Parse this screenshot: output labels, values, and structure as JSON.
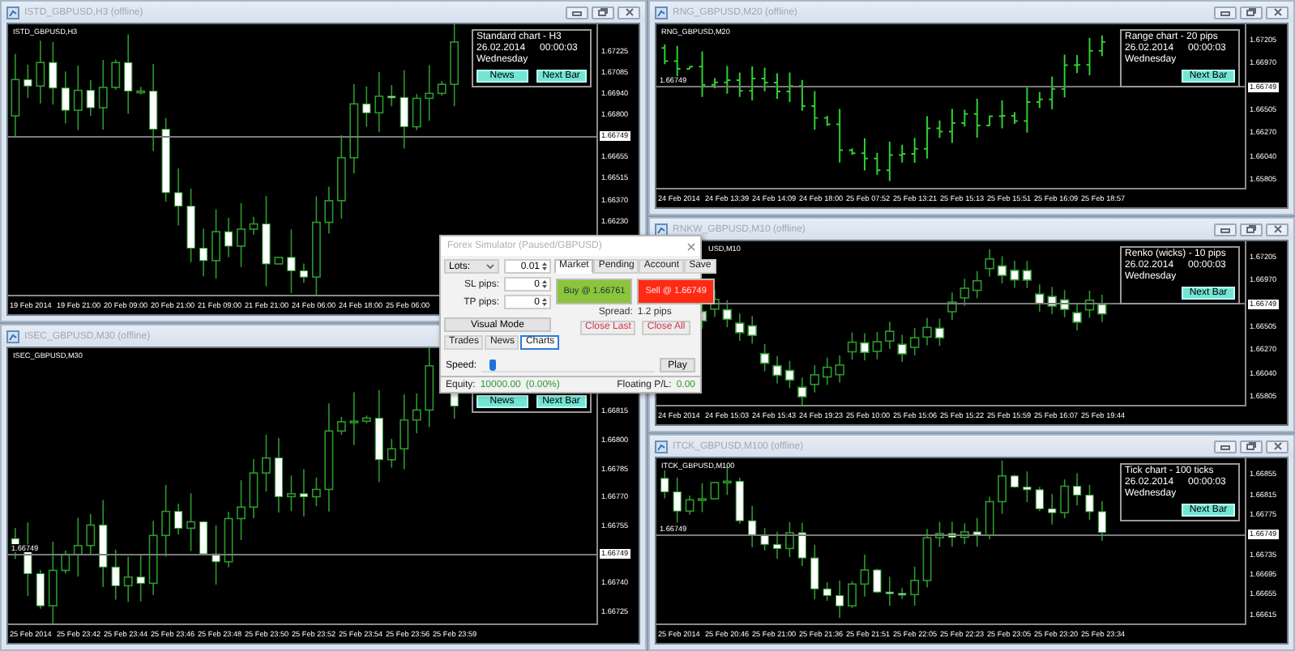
{
  "windows": [
    {
      "title": "ISTD_GBPUSD,H3 (offline)",
      "label": "ISTD_GBPUSD,H3",
      "kind": "candles",
      "window_buttons": true,
      "price_ticks": [
        {
          "text": "1.67225",
          "current": false
        },
        {
          "text": "1.67085",
          "current": false
        },
        {
          "text": "1.66940",
          "current": false
        },
        {
          "text": "1.66800",
          "current": false
        },
        {
          "text": "1.66749",
          "current": true
        },
        {
          "text": "1.66655",
          "current": false
        },
        {
          "text": "1.66515",
          "current": false
        },
        {
          "text": "1.66370",
          "current": false
        },
        {
          "text": "1.66230",
          "current": false
        }
      ],
      "time_ticks": [
        "19 Feb 2014",
        "19 Feb 21:00",
        "20 Feb 09:00",
        "20 Feb 21:00",
        "21 Feb 09:00",
        "21 Feb 21:00",
        "24 Feb 06:00",
        "24 Feb 18:00",
        "25 Feb 06:00"
      ],
      "info": {
        "title": "Standard chart - H3",
        "date": "26.02.2014",
        "time": "00:00:03",
        "day": "Wednesday",
        "buttons": [
          "News",
          "Next Bar"
        ]
      }
    },
    {
      "title": "RNG_GBPUSD,M20 (offline)",
      "label": "RNG_GBPUSD,M20",
      "kind": "bars",
      "window_buttons": true,
      "price_line_label": "1.66749",
      "price_ticks": [
        {
          "text": "1.67205",
          "current": false
        },
        {
          "text": "1.66970",
          "current": false
        },
        {
          "text": "1.66749",
          "current": true
        },
        {
          "text": "1.66505",
          "current": false
        },
        {
          "text": "1.66270",
          "current": false
        },
        {
          "text": "1.66040",
          "current": false
        },
        {
          "text": "1.65805",
          "current": false
        }
      ],
      "time_ticks": [
        "24 Feb 2014",
        "24 Feb 13:39",
        "24 Feb 14:09",
        "24 Feb 18:00",
        "25 Feb 07:52",
        "25 Feb 13:21",
        "25 Feb 15:13",
        "25 Feb 15:51",
        "25 Feb 16:09",
        "25 Feb 18:57"
      ],
      "info": {
        "title": "Range chart - 20 pips",
        "date": "26.02.2014",
        "time": "00:00:03",
        "day": "Wednesday",
        "buttons": [
          "Next Bar"
        ]
      }
    },
    {
      "title": "RNKW_GBPUSD,M10 (offline)",
      "label": "USD,M10",
      "kind": "renko",
      "window_buttons": true,
      "price_ticks": [
        {
          "text": "1.67205",
          "current": false
        },
        {
          "text": "1.66970",
          "current": false
        },
        {
          "text": "1.66749",
          "current": true
        },
        {
          "text": "1.66505",
          "current": false
        },
        {
          "text": "1.66270",
          "current": false
        },
        {
          "text": "1.66040",
          "current": false
        },
        {
          "text": "1.65805",
          "current": false
        }
      ],
      "time_ticks": [
        "24 Feb 2014",
        "24 Feb 15:03",
        "24 Feb 15:43",
        "24 Feb 19:23",
        "25 Feb 10:00",
        "25 Feb 15:06",
        "25 Feb 15:22",
        "25 Feb 15:59",
        "25 Feb 16:07",
        "25 Feb 19:44"
      ],
      "info": {
        "title": "Renko (wicks) - 10 pips",
        "date": "26.02.2014",
        "time": "00:00:03",
        "day": "Wednesday",
        "buttons": [
          "Next Bar"
        ]
      }
    },
    {
      "title": "ISEC_GBPUSD,M30 (offline)",
      "label": "ISEC_GBPUSD,M30",
      "kind": "candles",
      "window_buttons": false,
      "price_line_label": "1.66749",
      "price_ticks": [
        {
          "text": "1.66815",
          "current": false
        },
        {
          "text": "1.66800",
          "current": false
        },
        {
          "text": "1.66785",
          "current": false
        },
        {
          "text": "1.66770",
          "current": false
        },
        {
          "text": "1.66755",
          "current": false
        },
        {
          "text": "1.66749",
          "current": true
        },
        {
          "text": "1.66740",
          "current": false
        },
        {
          "text": "1.66725",
          "current": false
        }
      ],
      "time_ticks": [
        "25 Feb 2014",
        "25 Feb 23:42",
        "25 Feb 23:44",
        "25 Feb 23:46",
        "25 Feb 23:48",
        "25 Feb 23:50",
        "25 Feb 23:52",
        "25 Feb 23:54",
        "25 Feb 23:56",
        "25 Feb 23:59"
      ],
      "info": {
        "buttons": [
          "News",
          "Next Bar"
        ]
      }
    },
    {
      "title": "ITCK_GBPUSD,M100 (offline)",
      "label": "ITCK_GBPUSD,M100",
      "kind": "candles",
      "window_buttons": true,
      "price_line_label": "1.66749",
      "price_ticks": [
        {
          "text": "1.66855",
          "current": false
        },
        {
          "text": "1.66815",
          "current": false
        },
        {
          "text": "1.66775",
          "current": false
        },
        {
          "text": "1.66749",
          "current": true
        },
        {
          "text": "1.66735",
          "current": false
        },
        {
          "text": "1.66695",
          "current": false
        },
        {
          "text": "1.66655",
          "current": false
        },
        {
          "text": "1.66615",
          "current": false
        }
      ],
      "time_ticks": [
        "25 Feb 2014",
        "25 Feb 20:46",
        "25 Feb 21:00",
        "25 Feb 21:36",
        "25 Feb 21:51",
        "25 Feb 22:05",
        "25 Feb 22:23",
        "25 Feb 23:05",
        "25 Feb 23:20",
        "25 Feb 23:34"
      ],
      "info": {
        "title": "Tick chart - 100 ticks",
        "date": "26.02.2014",
        "time": "00:00:03",
        "day": "Wednesday",
        "buttons": [
          "Next Bar"
        ]
      }
    }
  ],
  "dialog": {
    "title": "Forex Simulator (Paused/GBPUSD)",
    "lots": {
      "label": "Lots:",
      "value": "0.01"
    },
    "fields": [
      {
        "label": "SL pips:",
        "value": "0"
      },
      {
        "label": "TP pips:",
        "value": "0"
      }
    ],
    "visual_mode": "Visual Mode",
    "left_tabs": [
      {
        "label": "Trades",
        "selected": false
      },
      {
        "label": "News",
        "selected": false
      },
      {
        "label": "Charts",
        "selected": true
      }
    ],
    "right_tabs": [
      {
        "label": "Market",
        "selected": true
      },
      {
        "label": "Pending",
        "selected": false
      },
      {
        "label": "Account",
        "selected": false
      },
      {
        "label": "Save",
        "selected": false
      }
    ],
    "trade_buttons": [
      {
        "kind": "buy",
        "label": "Buy @ 1.66761"
      },
      {
        "kind": "sell",
        "label": "Sell @ 1.66749"
      }
    ],
    "spread": {
      "label": "Spread:",
      "value": "1.2 pips"
    },
    "close_buttons": [
      "Close Last",
      "Close All"
    ],
    "speed": {
      "label": "Speed:",
      "level": 0.05
    },
    "play": "Play",
    "status": {
      "equity_label": "Equity:",
      "equity": "10000.00",
      "equity_change": "(0.00%)",
      "pl_label": "Floating P/L:",
      "pl": "0.00"
    }
  }
}
